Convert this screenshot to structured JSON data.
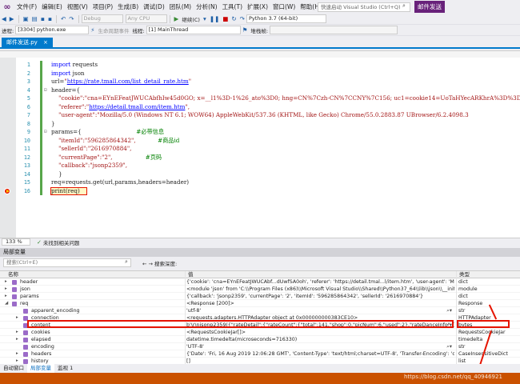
{
  "menu": {
    "items": [
      "文件(F)",
      "编辑(E)",
      "视图(V)",
      "项目(P)",
      "生成(B)",
      "调试(D)",
      "团队(M)",
      "分析(N)",
      "工具(T)",
      "扩展(X)",
      "窗口(W)",
      "帮助(H)"
    ],
    "quick_launch_placeholder": "快速启动 Visual Studio (Ctrl+Q)",
    "window_title": "邮件发送"
  },
  "toolbar1": {
    "config": "Debug",
    "platform": "Any CPU",
    "continue_label": "继续(C)",
    "python_env": "Python 3.7 (64-bit)"
  },
  "toolbar2": {
    "process_label": "进程:",
    "process": "[3304] python.exe",
    "lifecycle": "生命周期事件",
    "thread_label": "线程:",
    "thread": "[1] MainThread",
    "stackframe_label": "堆栈帧:"
  },
  "doc_tab": {
    "label": "邮件发送.py",
    "close": "×"
  },
  "editor": {
    "lines": [
      {
        "n": "1",
        "tokens": [
          [
            "kw",
            "import"
          ],
          [
            "",
            " requests"
          ]
        ]
      },
      {
        "n": "2",
        "tokens": [
          [
            "kw",
            "import"
          ],
          [
            "",
            " json"
          ]
        ]
      },
      {
        "n": "3",
        "tokens": [
          [
            "",
            "url="
          ],
          [
            "str",
            "\""
          ],
          [
            "url",
            "https://rate.tmall.com/list_detail_rate.htm"
          ],
          [
            "str",
            "\""
          ]
        ]
      },
      {
        "n": "4",
        "fold": "⊟",
        "tokens": [
          [
            "",
            "header={"
          ]
        ]
      },
      {
        "n": "5",
        "tokens": [
          [
            "str",
            "    \"cookie\":\"cna=EYnEFeatJWUCAbfhIw45d0GO; x=__l1%3D-1%26_ato%3D0; hng=CN%7Czh-CN%7CCNY%7C156; uc1=cookie14=UoTaHYecARKhrA%3D%3D; u"
          ]
        ]
      },
      {
        "n": "6",
        "tokens": [
          [
            "str",
            "    \"referer\":"
          ],
          [
            "str",
            "\""
          ],
          [
            "url",
            "https://detail.tmall.com/item.htm"
          ],
          [
            "str",
            "\","
          ]
        ]
      },
      {
        "n": "7",
        "tokens": [
          [
            "str",
            "    \"user-agent\":\"Mozilla/5.0 (Windows NT 6.1; WOW64) AppleWebKit/537.36 (KHTML, like Gecko) Chrome/55.0.2883.87 UBrowser/6.2.4098.3"
          ]
        ]
      },
      {
        "n": "8",
        "tokens": [
          [
            "",
            "}"
          ]
        ]
      },
      {
        "n": "9",
        "fold": "⊟",
        "tokens": [
          [
            "",
            "params={                              "
          ],
          [
            "com",
            "#必带信息"
          ]
        ]
      },
      {
        "n": "10",
        "tokens": [
          [
            "str",
            "    \"itemId\":\"596285864342\",            "
          ],
          [
            "com",
            "#商品id"
          ]
        ]
      },
      {
        "n": "11",
        "tokens": [
          [
            "str",
            "    \"sellerId\":\"2616970884\","
          ]
        ]
      },
      {
        "n": "12",
        "tokens": [
          [
            "str",
            "    \"currentPage\":\"2\",                  "
          ],
          [
            "com",
            "#页码"
          ]
        ]
      },
      {
        "n": "13",
        "tokens": [
          [
            "str",
            "    \"callback\":\"jsonp2359\","
          ]
        ]
      },
      {
        "n": "14",
        "tokens": [
          [
            "",
            "    }"
          ]
        ]
      },
      {
        "n": "15",
        "tokens": [
          [
            "",
            "req=requests.get(url,params,headers=header)"
          ]
        ]
      },
      {
        "n": "16",
        "tokens": [
          [
            "",
            "print(req)"
          ]
        ]
      }
    ]
  },
  "editor_status": {
    "zoom": "133 %",
    "ok_icon": "✓",
    "message": "未找到相关问题"
  },
  "locals": {
    "title": "局部变量",
    "search_placeholder": "搜索(Ctrl+E)",
    "search_depth_label": "搜索深度:",
    "col_name": "名称",
    "col_value": "值",
    "col_type": "类型",
    "rows": [
      {
        "indent": 0,
        "exp": "▸",
        "name": "header",
        "value": "{'cookie': 'cna=EYnEFeatJWUCAbf...dUwfSA0oh', 'referer': 'https://detail.tmal...l/item.htm', 'user-agent': 'Mozilla/5.0 (Wind...",
        "type": "dict"
      },
      {
        "indent": 0,
        "exp": "▸",
        "name": "json",
        "value": "<module 'json' from 'C:\\\\Program Files (x86)\\\\Microsoft Visual Studio\\\\Shared\\\\Python37_64\\\\lib\\\\json\\\\__init__.py'>",
        "type": "module"
      },
      {
        "indent": 0,
        "exp": "▸",
        "name": "params",
        "value": "{'callback': 'jsonp2359', 'currentPage': '2', 'itemId': '596285864342', 'sellerId': '2616970884'}",
        "type": "dict"
      },
      {
        "indent": 0,
        "exp": "◢",
        "name": "req",
        "value": "<Response [200]>",
        "type": "Response"
      },
      {
        "indent": 1,
        "exp": "",
        "name": "apparent_encoding",
        "value": "'utf-8'",
        "type": "str",
        "lens": true
      },
      {
        "indent": 1,
        "exp": "▸",
        "name": "connection",
        "value": "<requests.adapters.HTTPAdapter object at 0x000000000383CE10>",
        "type": "HTTPAdapter"
      },
      {
        "indent": 1,
        "exp": "",
        "name": "content",
        "value": "b'\\r\\njsonp2359({\"rateDetail\":{\"rateCount\":{\"total\":141,\"shop\":0,\"picNum\":6,\"used\":2},\"rateDanceInfo\":{\"storeType\":4,...",
        "type": "bytes",
        "lens": true
      },
      {
        "indent": 1,
        "exp": "▸",
        "name": "cookies",
        "value": "<RequestsCookieJar[]>",
        "type": "RequestsCookieJar"
      },
      {
        "indent": 1,
        "exp": "▸",
        "name": "elapsed",
        "value": "datetime.timedelta(microseconds=716330)",
        "type": "timedelta"
      },
      {
        "indent": 1,
        "exp": "",
        "name": "encoding",
        "value": "'UTF-8'",
        "type": "str",
        "lens": true
      },
      {
        "indent": 1,
        "exp": "▸",
        "name": "headers",
        "value": "{'Date': 'Fri, 16 Aug 2019 12:06:28 GMT', 'Content-Type': 'text/html;charset=UTF-8', 'Transfer-Encoding': 'chunked', 'Conne...",
        "type": "CaseInsensitiveDict"
      },
      {
        "indent": 1,
        "exp": "▸",
        "name": "history",
        "value": "[]",
        "type": "list"
      }
    ]
  },
  "bottom_tabs": [
    "自动窗口",
    "局部变量",
    "监视 1"
  ],
  "watermark": "https://blog.csdn.net/qq_40946921",
  "colors": {
    "accent": "#007acc",
    "status_bar": "#ca5100",
    "highlight": "#e51400",
    "vs_purple": "#68217a"
  }
}
